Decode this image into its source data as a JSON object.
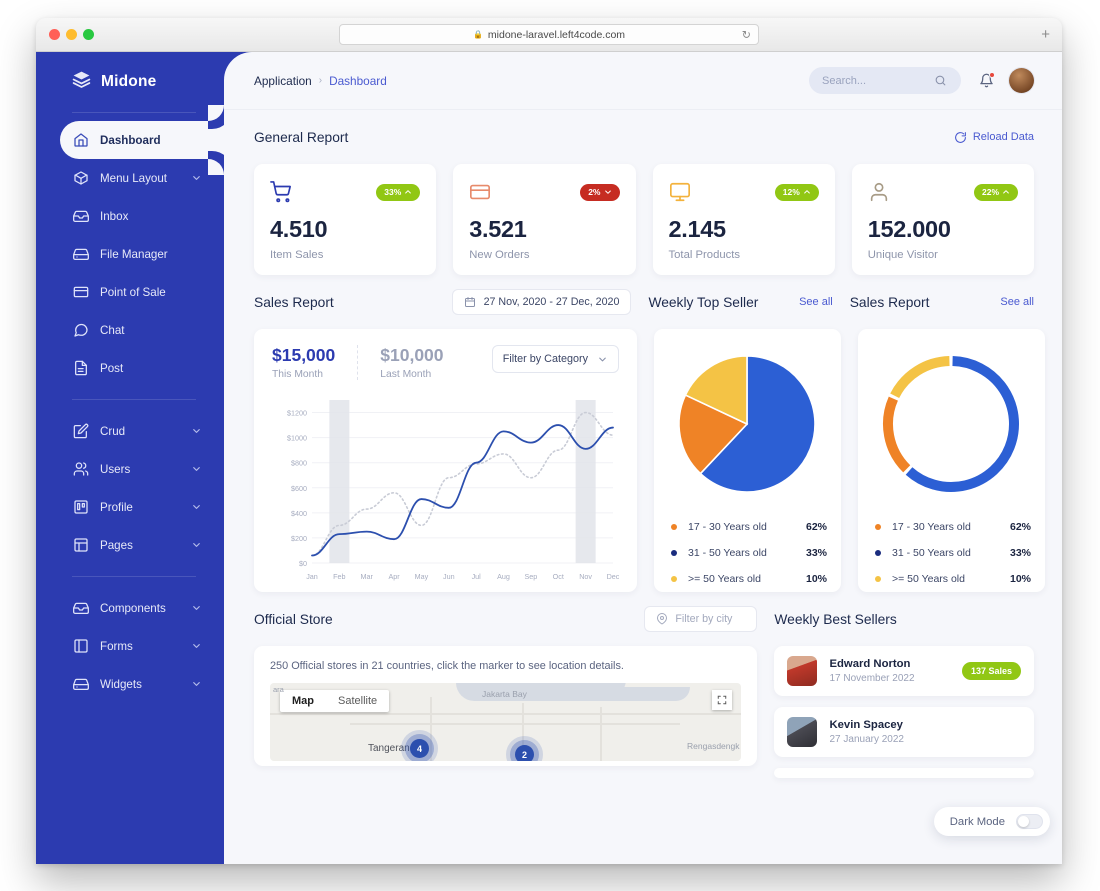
{
  "browser": {
    "url": "midone-laravel.left4code.com",
    "lock_icon": "lock-icon",
    "reload_icon": "reload-icon",
    "new_tab_label": "+"
  },
  "sidebar": {
    "brand": "Midone",
    "brand_icon": "layers-icon",
    "items": [
      {
        "label": "Dashboard",
        "icon": "home-icon",
        "active": true,
        "chevron": false
      },
      {
        "label": "Menu Layout",
        "icon": "box-icon",
        "active": false,
        "chevron": true
      },
      {
        "label": "Inbox",
        "icon": "inbox-icon",
        "active": false,
        "chevron": false
      },
      {
        "label": "File Manager",
        "icon": "hard-drive-icon",
        "active": false,
        "chevron": false
      },
      {
        "label": "Point of Sale",
        "icon": "credit-card-icon",
        "active": false,
        "chevron": false
      },
      {
        "label": "Chat",
        "icon": "message-icon",
        "active": false,
        "chevron": false
      },
      {
        "label": "Post",
        "icon": "file-text-icon",
        "active": false,
        "chevron": false
      },
      {
        "label": "Crud",
        "icon": "edit-icon",
        "active": false,
        "chevron": true,
        "gap_before": true
      },
      {
        "label": "Users",
        "icon": "users-icon",
        "active": false,
        "chevron": true
      },
      {
        "label": "Profile",
        "icon": "trello-icon",
        "active": false,
        "chevron": true
      },
      {
        "label": "Pages",
        "icon": "layout-icon",
        "active": false,
        "chevron": true
      },
      {
        "label": "Components",
        "icon": "inbox-icon",
        "active": false,
        "chevron": true,
        "gap_before": true
      },
      {
        "label": "Forms",
        "icon": "sidebar-icon",
        "active": false,
        "chevron": true
      },
      {
        "label": "Widgets",
        "icon": "hard-drive-icon",
        "active": false,
        "chevron": true
      }
    ]
  },
  "topbar": {
    "breadcrumb_root": "Application",
    "breadcrumb_sep": "›",
    "breadcrumb_current": "Dashboard",
    "search_placeholder": "Search...",
    "search_value": "",
    "search_icon": "search-icon",
    "bell_icon": "bell-icon",
    "bell_has_badge": true,
    "avatar": "user-avatar"
  },
  "general_report": {
    "title": "General Report",
    "reload_label": "Reload Data",
    "reload_icon": "refresh-icon",
    "cards": [
      {
        "icon": "shopping-cart-icon",
        "icon_color": "#2c3bb0",
        "value": "4.510",
        "label": "Item Sales",
        "badge": "33%",
        "direction": "up",
        "badge_color": "#91c714"
      },
      {
        "icon": "credit-card-icon",
        "icon_color": "#e78a6b",
        "value": "3.521",
        "label": "New Orders",
        "badge": "2%",
        "direction": "down",
        "badge_color": "#c62c22"
      },
      {
        "icon": "monitor-icon",
        "icon_color": "#f3b23c",
        "value": "2.145",
        "label": "Total Products",
        "badge": "12%",
        "direction": "up",
        "badge_color": "#91c714"
      },
      {
        "icon": "user-icon",
        "icon_color": "#a79b86",
        "value": "152.000",
        "label": "Unique Visitor",
        "badge": "22%",
        "direction": "up",
        "badge_color": "#91c714"
      }
    ]
  },
  "sales_report": {
    "title": "Sales Report",
    "date_range": "27 Nov, 2020 - 27 Dec, 2020",
    "calendar_icon": "calendar-icon",
    "this_month_value": "$15,000",
    "this_month_label": "This Month",
    "last_month_value": "$10,000",
    "last_month_label": "Last Month",
    "filter_label": "Filter by Category",
    "filter_chevron": "chevron-down-icon"
  },
  "chart_data": [
    {
      "type": "line",
      "title": "Sales Report",
      "xlabel": "",
      "ylabel": "",
      "ylim": [
        0,
        1300
      ],
      "grid": true,
      "legend_position": "none",
      "categories": [
        "Jan",
        "Feb",
        "Mar",
        "Apr",
        "May",
        "Jun",
        "Jul",
        "Aug",
        "Sep",
        "Oct",
        "Nov",
        "Dec"
      ],
      "ytick_labels": [
        "$0",
        "$200",
        "$400",
        "$600",
        "$800",
        "$1000",
        "$1200"
      ],
      "ytick_values": [
        0,
        200,
        400,
        600,
        800,
        1000,
        1200
      ],
      "series": [
        {
          "name": "This Month",
          "style": "solid",
          "color": "#2c4fae",
          "values": [
            60,
            230,
            250,
            190,
            510,
            440,
            800,
            1050,
            960,
            1100,
            910,
            1080
          ]
        },
        {
          "name": "Last Month",
          "style": "dotted",
          "color": "#c9ccd6",
          "values": [
            60,
            300,
            430,
            560,
            300,
            680,
            790,
            870,
            680,
            900,
            1200,
            1020
          ]
        }
      ],
      "highlight_bands": [
        "Feb",
        "Nov"
      ]
    },
    {
      "type": "pie",
      "title": "Weekly Top Seller",
      "labels": [
        "17 - 30 Years old",
        "31 - 50 Years old",
        ">= 50 Years old"
      ],
      "values": [
        62,
        33,
        10
      ],
      "display_percents": [
        "62%",
        "33%",
        "10%"
      ],
      "colors": [
        "#2c5fd4",
        "#ef8326",
        "#f4c345"
      ],
      "legend_position": "bottom"
    },
    {
      "type": "pie",
      "title": "Sales Report",
      "donut": true,
      "labels": [
        "17 - 30 Years old",
        "31 - 50 Years old",
        ">= 50 Years old"
      ],
      "values": [
        62,
        33,
        10
      ],
      "display_percents": [
        "62%",
        "33%",
        "10%"
      ],
      "colors": [
        "#2c5fd4",
        "#ef8326",
        "#f4c345"
      ],
      "legend_position": "bottom"
    }
  ],
  "weekly_top_seller": {
    "title": "Weekly Top Seller",
    "see_all": "See all",
    "legend": [
      {
        "label": "17 - 30 Years old",
        "percent": "62%",
        "color": "#ef8326"
      },
      {
        "label": "31 - 50 Years old",
        "percent": "33%",
        "color": "#1a2c7e"
      },
      {
        "label": ">= 50 Years old",
        "percent": "10%",
        "color": "#f4c345"
      }
    ]
  },
  "sales_report_donut": {
    "title": "Sales Report",
    "see_all": "See all",
    "legend": [
      {
        "label": "17 - 30 Years old",
        "percent": "62%",
        "color": "#ef8326"
      },
      {
        "label": "31 - 50 Years old",
        "percent": "33%",
        "color": "#1a2c7e"
      },
      {
        "label": ">= 50 Years old",
        "percent": "10%",
        "color": "#f4c345"
      }
    ]
  },
  "official_store": {
    "title": "Official Store",
    "city_filter_placeholder": "Filter by city",
    "city_filter_icon": "map-pin-icon",
    "note": "250 Official stores in 21 countries, click the marker to see location details.",
    "map": {
      "toggle": [
        "Map",
        "Satellite"
      ],
      "selected_toggle": "Map",
      "fullscreen_icon": "fullscreen-icon",
      "labels": [
        "ara",
        "Jakarta Bay",
        "Rengasdengk"
      ],
      "city": "Tangerang",
      "markers": [
        "4",
        "2"
      ]
    }
  },
  "weekly_best_sellers": {
    "title": "Weekly Best Sellers",
    "items": [
      {
        "name": "Edward Norton",
        "date": "17 November 2022",
        "badge": "137 Sales",
        "avatar": "avatar-edward"
      },
      {
        "name": "Kevin Spacey",
        "date": "27 January 2022",
        "badge": "",
        "avatar": "avatar-kevin"
      }
    ]
  },
  "dark_mode": {
    "label": "Dark Mode",
    "enabled": false
  }
}
